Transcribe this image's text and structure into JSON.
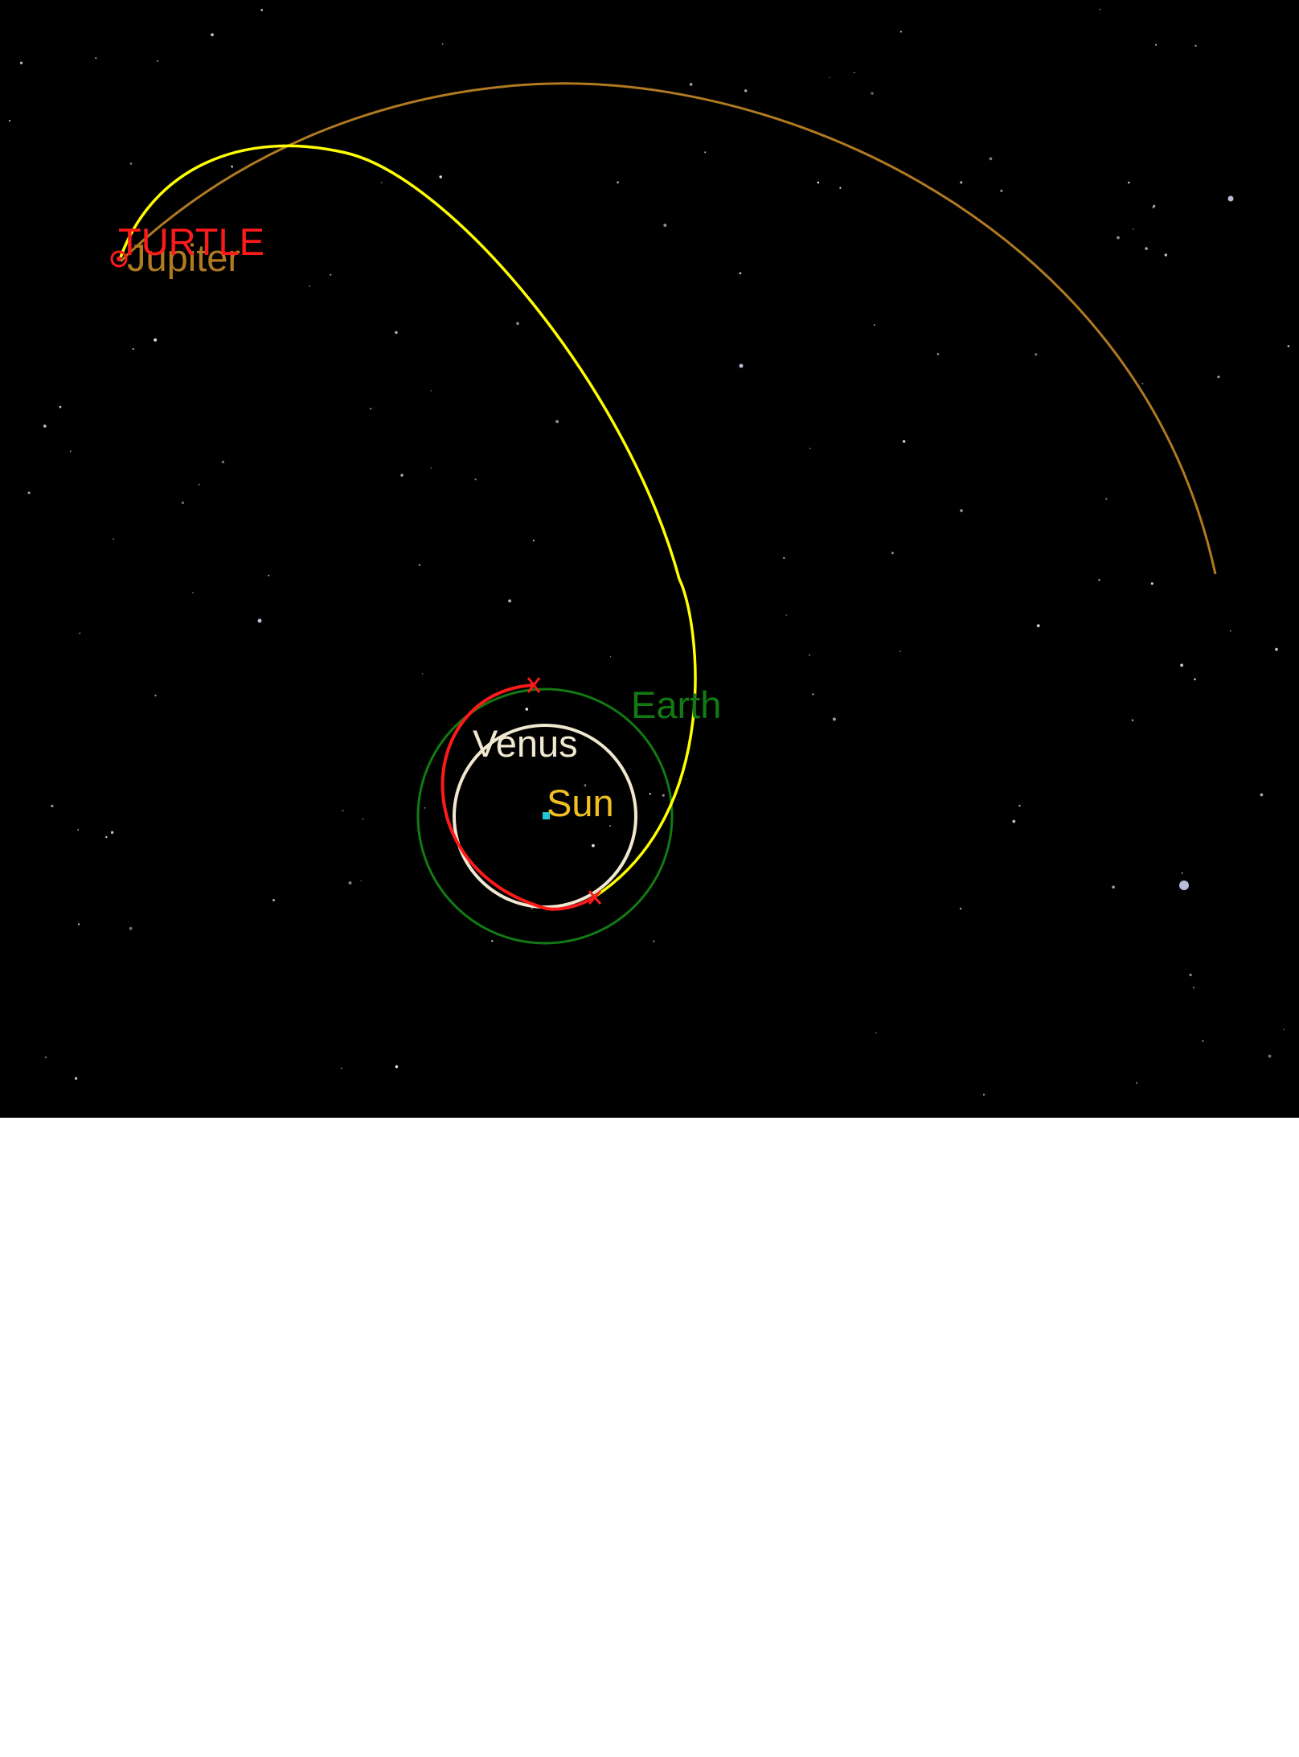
{
  "view": {
    "background": "#000000"
  },
  "bodies": {
    "sun": {
      "label": "Sun",
      "color": "#f0c020",
      "marker_color": "#22c8d8"
    },
    "venus": {
      "label": "Venus",
      "color": "#f0e8d0"
    },
    "earth": {
      "label": "Earth",
      "color": "#127a12"
    },
    "jupiter": {
      "label": "Jupiter",
      "color": "#b07a20"
    }
  },
  "spacecraft": {
    "label": "TURTLE",
    "color": "#ff1a1a",
    "trajectory_color": "#ffff00"
  }
}
